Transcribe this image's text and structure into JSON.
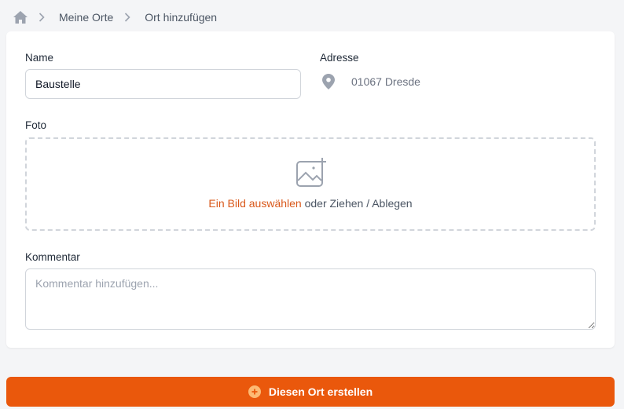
{
  "breadcrumb": {
    "items": [
      "Meine Orte",
      "Ort hinzufügen"
    ]
  },
  "form": {
    "name_label": "Name",
    "name_value": "Baustelle",
    "address_label": "Adresse",
    "address_value": "01067 Dresde",
    "photo_label": "Foto",
    "photo_choose_link": "Ein Bild auswählen",
    "photo_drop_text": " oder Ziehen / Ablegen",
    "comment_label": "Kommentar",
    "comment_placeholder": "Kommentar hinzufügen..."
  },
  "submit": {
    "label": "Diesen Ort erstellen"
  },
  "icons": {
    "home": "home-icon",
    "separator": "chevron-right-icon",
    "address": "map-pin-icon",
    "photo": "image-add-icon",
    "submit": "plus-circle-icon"
  },
  "colors": {
    "accent": "#ea580c",
    "link": "#d9581a",
    "icon_gray": "#9ca3af",
    "background": "#f4f5f7"
  }
}
